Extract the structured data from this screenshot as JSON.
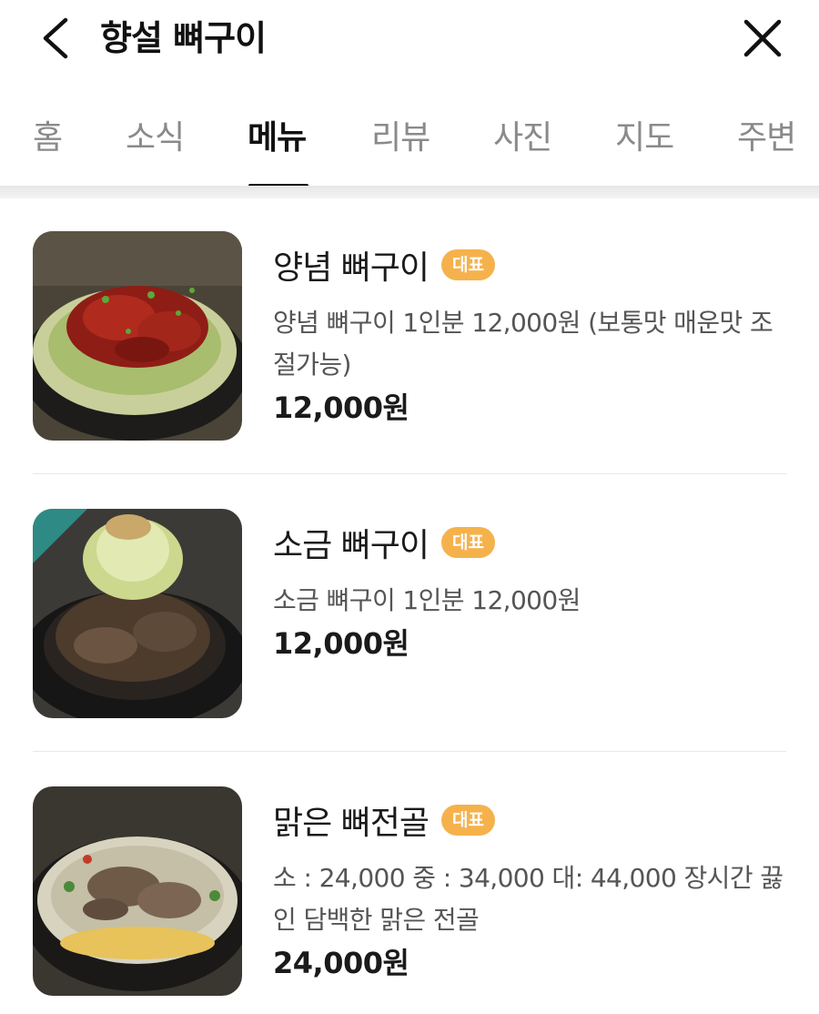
{
  "header": {
    "title": "향설 뼈구이",
    "back_icon": "chevron-left-icon",
    "close_icon": "close-icon"
  },
  "tabs": [
    {
      "label": "홈",
      "active": false
    },
    {
      "label": "소식",
      "active": false
    },
    {
      "label": "메뉴",
      "active": true
    },
    {
      "label": "리뷰",
      "active": false
    },
    {
      "label": "사진",
      "active": false
    },
    {
      "label": "지도",
      "active": false
    },
    {
      "label": "주변",
      "active": false
    }
  ],
  "colors": {
    "badge": "#f5b24c",
    "active_tab": "#111111",
    "inactive_tab": "#8a8a8a"
  },
  "menu_items": [
    {
      "name": "양념 뼈구이",
      "badge": "대표",
      "description": "양념 뼈구이 1인분 12,000원 (보통맛 매운맛 조절가능)",
      "price": "12,000원",
      "image": "spicy-bone-grill-photo"
    },
    {
      "name": "소금 뼈구이",
      "badge": "대표",
      "description": "소금 뼈구이 1인분 12,000원",
      "price": "12,000원",
      "image": "salt-bone-grill-photo"
    },
    {
      "name": "맑은 뼈전골",
      "badge": "대표",
      "description": "소 : 24,000 중 : 34,000 대: 44,000 장시간 끓인 담백한 맑은 전골",
      "price": "24,000원",
      "image": "clear-bone-hotpot-photo"
    }
  ]
}
